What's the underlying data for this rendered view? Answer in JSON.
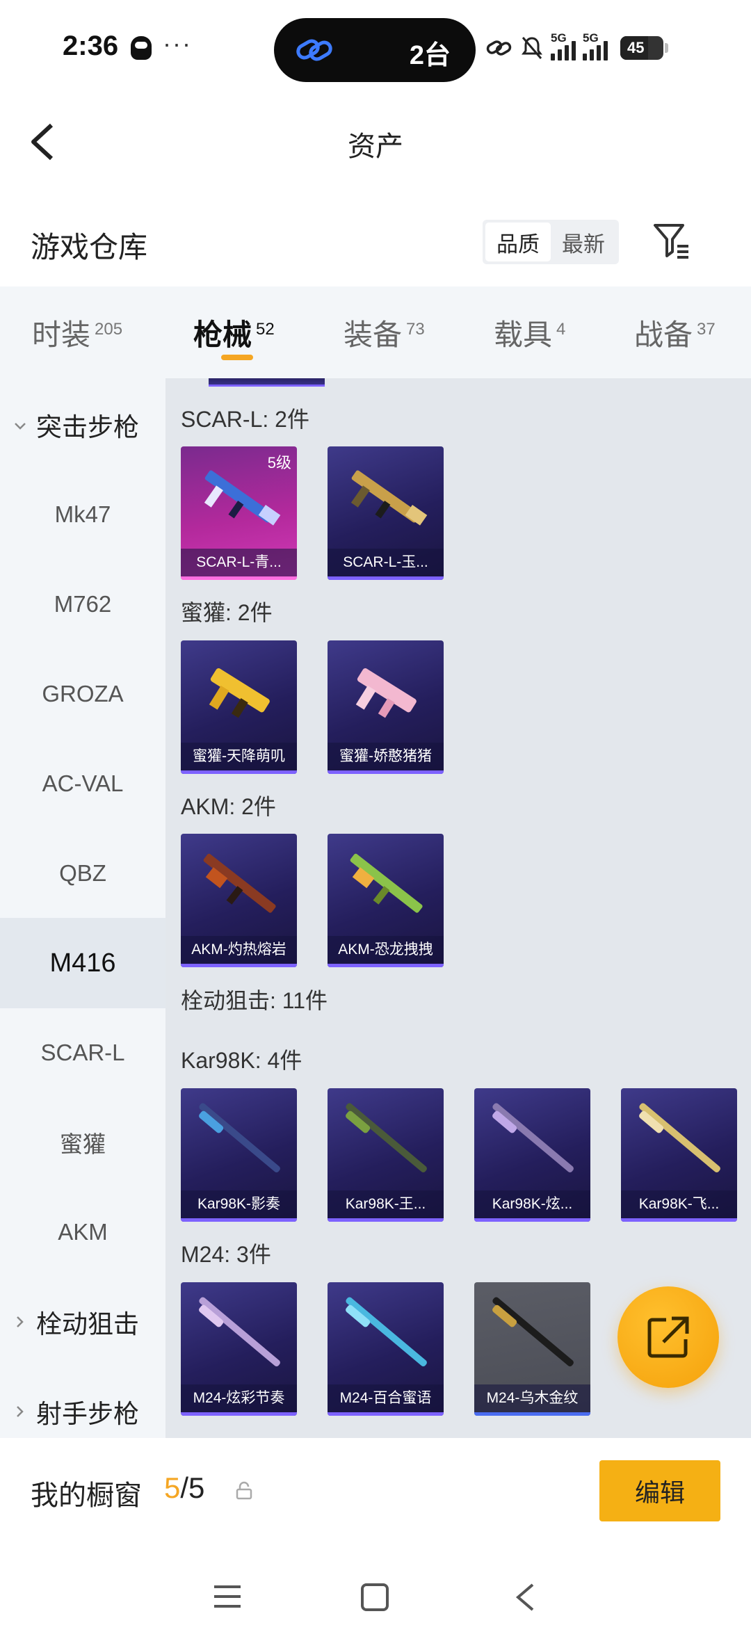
{
  "status_bar": {
    "time": "2:36",
    "dots": "···",
    "pill_text": "2台",
    "network": "5G",
    "battery": "45"
  },
  "header": {
    "title": "资产"
  },
  "warehouse": {
    "title": "游戏仓库",
    "sort_options": [
      "品质",
      "最新"
    ]
  },
  "tabs": [
    {
      "label": "时装",
      "count": "205"
    },
    {
      "label": "枪械",
      "count": "52"
    },
    {
      "label": "装备",
      "count": "73"
    },
    {
      "label": "载具",
      "count": "4"
    },
    {
      "label": "战备",
      "count": "37"
    }
  ],
  "sidebar": [
    {
      "label": "突击步枪"
    },
    {
      "label": "Mk47"
    },
    {
      "label": "M762"
    },
    {
      "label": "GROZA"
    },
    {
      "label": "AC-VAL"
    },
    {
      "label": "QBZ"
    },
    {
      "label": "M416"
    },
    {
      "label": "SCAR-L"
    },
    {
      "label": "蜜獾"
    },
    {
      "label": "AKM"
    },
    {
      "label": "栓动狙击"
    },
    {
      "label": "射手步枪"
    }
  ],
  "groups": [
    {
      "title": "SCAR-L: 2件",
      "items": [
        {
          "name": "SCAR-L-青...",
          "level": "5级"
        },
        {
          "name": "SCAR-L-玉..."
        }
      ]
    },
    {
      "title": "蜜獾: 2件",
      "items": [
        {
          "name": "蜜獾-天降萌叽"
        },
        {
          "name": "蜜獾-娇憨猪猪"
        }
      ]
    },
    {
      "title": "AKM: 2件",
      "items": [
        {
          "name": "AKM-灼热熔岩"
        },
        {
          "name": "AKM-恐龙拽拽"
        }
      ]
    },
    {
      "title": "栓动狙击: 11件"
    },
    {
      "title": "Kar98K: 4件",
      "items": [
        {
          "name": "Kar98K-影奏"
        },
        {
          "name": "Kar98K-王..."
        },
        {
          "name": "Kar98K-炫..."
        },
        {
          "name": "Kar98K-飞..."
        }
      ]
    },
    {
      "title": "M24: 3件",
      "items": [
        {
          "name": "M24-炫彩节奏"
        },
        {
          "name": "M24-百合蜜语"
        },
        {
          "name": "M24-乌木金纹"
        }
      ]
    }
  ],
  "showcase": {
    "label": "我的橱窗",
    "current": "5",
    "total": "/5",
    "edit_label": "编辑"
  },
  "colors": {
    "accent": "#f5a623",
    "card_bg": "#2c2570",
    "card_legendary": "#b3299c"
  }
}
